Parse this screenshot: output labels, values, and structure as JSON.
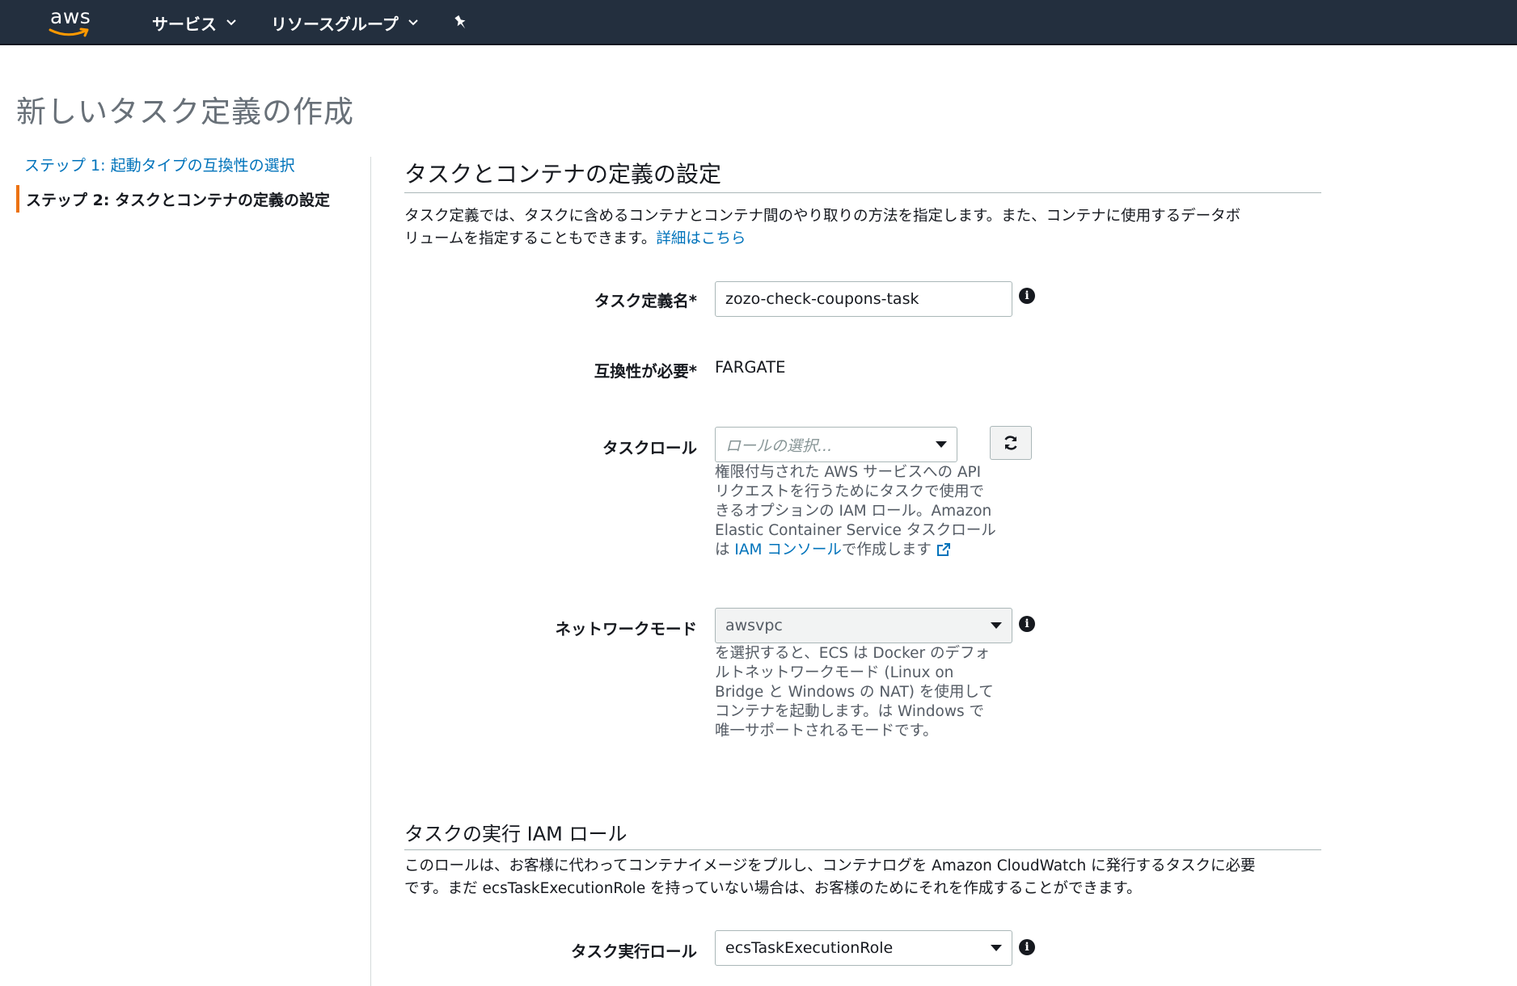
{
  "nav": {
    "logo_text": "aws",
    "services_label": "サービス",
    "resource_groups_label": "リソースグループ"
  },
  "page": {
    "title": "新しいタスク定義の作成"
  },
  "steps": [
    {
      "label": "ステップ 1: 起動タイプの互換性の選択"
    },
    {
      "label": "ステップ 2: タスクとコンテナの定義の設定"
    }
  ],
  "task_container": {
    "title": "タスクとコンテナの定義の設定",
    "description_line1": "タスク定義では、タスクに含めるコンテナとコンテナ間のやり取りの方法を指定します。また、コンテナに使用するデータボ",
    "description_line2": "リュームを指定することもできます。",
    "learn_more_link": "詳細はこちら"
  },
  "form": {
    "task_definition_name": {
      "label": "タスク定義名*",
      "value": "zozo-check-coupons-task"
    },
    "compatibility": {
      "label": "互換性が必要*",
      "value": "FARGATE"
    },
    "task_role": {
      "label": "タスクロール",
      "placeholder": "ロールの選択...",
      "help_line1": "権限付与された AWS サービスへの API",
      "help_line2": "リクエストを行うためにタスクで使用で",
      "help_line3": "きるオプションの IAM ロール。Amazon",
      "help_line4": "Elastic Container Service タスクロール",
      "help_prefix": "は ",
      "help_link": "IAM コンソール",
      "help_suffix": "で作成します"
    },
    "network_mode": {
      "label": "ネットワークモード",
      "value": "awsvpc",
      "help_line1": "を選択すると、ECS は Docker のデフォ",
      "help_line2": "ルトネットワークモード (Linux on",
      "help_line3": "Bridge と Windows の NAT) を使用して",
      "help_line4": "コンテナを起動します。は Windows で",
      "help_line5": "唯一サポートされるモードです。"
    }
  },
  "execution_role": {
    "title": "タスクの実行 IAM ロール",
    "description_line1": "このロールは、お客様に代わってコンテナイメージをプルし、コンテナログを Amazon CloudWatch に発行するタスクに必要",
    "description_line2": "です。まだ ecsTaskExecutionRole を持っていない場合は、お客様のためにそれを作成することができます。",
    "label": "タスク実行ロール",
    "value": "ecsTaskExecutionRole"
  },
  "colors": {
    "nav_bg": "#232f3e",
    "link": "#0073bb",
    "active_step_marker": "#ec7211",
    "title_gray": "#687078"
  }
}
